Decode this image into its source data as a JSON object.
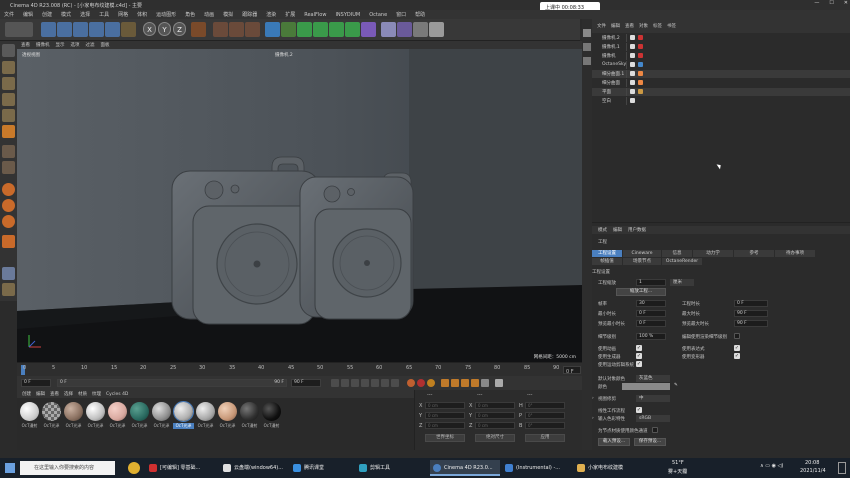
{
  "window": {
    "title": "Cinema 4D R23.008 (RC) - [小家电布纹建模.c4d] - 主要",
    "buttons": [
      "—",
      "☐",
      "✕"
    ]
  },
  "recording": {
    "label": "上课中 00:08:33"
  },
  "menubar": [
    "文件",
    "编辑",
    "创建",
    "模式",
    "选择",
    "工具",
    "网格",
    "体积",
    "运动图形",
    "角色",
    "动画",
    "模拟",
    "跟踪器",
    "渲染",
    "扩展",
    "RealFlow",
    "INSYDIUM",
    "Octane",
    "窗口",
    "帮助"
  ],
  "viewport": {
    "menu": [
      "查看",
      "摄像机",
      "显示",
      "选项",
      "过滤",
      "面板"
    ],
    "label": "透视视图",
    "camera": "摄像机.2",
    "grid_info": "网格间距：5000 cm"
  },
  "timeline": {
    "ticks": [
      "0",
      "5",
      "10",
      "15",
      "20",
      "25",
      "30",
      "35",
      "40",
      "45",
      "50",
      "55",
      "60",
      "65",
      "70",
      "75",
      "80",
      "85",
      "90"
    ],
    "current": "0 F",
    "start": "0 F",
    "field_start": "0 F",
    "end": "90 F",
    "end2": "90 F"
  },
  "materials": {
    "menu": [
      "创建",
      "编辑",
      "查看",
      "选择",
      "材质",
      "纹理",
      "Cycles 4D"
    ],
    "items": [
      {
        "label": "OcT漫射",
        "color": "#e8e8e8"
      },
      {
        "label": "OcT光泽",
        "color": "checker"
      },
      {
        "label": "OcT光泽",
        "color": "#8a7060"
      },
      {
        "label": "OcT光泽",
        "color": "#c0c0c0"
      },
      {
        "label": "OcT光泽",
        "color": "#d9a9a0"
      },
      {
        "label": "OcT光泽",
        "color": "#2a6a60"
      },
      {
        "label": "OcT光泽",
        "color": "#909090"
      },
      {
        "label": "OcT光泽",
        "color": "#b0b0b0"
      },
      {
        "label": "OcT光泽",
        "color": "#c89878"
      },
      {
        "label": "OcT光泽",
        "color": "#a8a8a8"
      },
      {
        "label": "OcT漫射",
        "color": "#303030"
      },
      {
        "label": "OcT漫射",
        "color": "#101010"
      }
    ]
  },
  "coords": {
    "header": [
      "---",
      "---",
      "---"
    ],
    "rows": [
      {
        "a": "X",
        "v1": "0 cm",
        "b": "X",
        "v2": "0 cm",
        "c": "H",
        "v3": "0°"
      },
      {
        "a": "Y",
        "v1": "0 cm",
        "b": "Y",
        "v2": "0 cm",
        "c": "P",
        "v3": "0°"
      },
      {
        "a": "Z",
        "v1": "0 cm",
        "b": "Z",
        "v2": "0 cm",
        "c": "B",
        "v3": "0°"
      }
    ],
    "mode1": "世界坐标",
    "mode2": "绝对尺寸",
    "apply": "应用"
  },
  "objects": {
    "menu": [
      "文件",
      "编辑",
      "查看",
      "对象",
      "标签",
      "书签"
    ],
    "items": [
      {
        "name": "摄像机.2",
        "tags": [
          "#ddd",
          "#c33"
        ]
      },
      {
        "name": "摄像机.1",
        "tags": [
          "#ddd",
          "#c33"
        ]
      },
      {
        "name": "摄像机",
        "tags": [
          "#ddd",
          "#c33"
        ]
      },
      {
        "name": "OctaneSky",
        "tags": [
          "#ddd",
          "#48c"
        ]
      },
      {
        "name": "细分曲面.1",
        "tags": [
          "#ddd",
          "#e84"
        ]
      },
      {
        "name": "细分曲面",
        "tags": [
          "#ddd",
          "#e84"
        ]
      },
      {
        "name": "平面",
        "tags": [
          "#ddd",
          "#c94"
        ]
      },
      {
        "name": "空白",
        "tags": [
          "#ddd"
        ]
      }
    ]
  },
  "attributes": {
    "menu": [
      "模式",
      "编辑",
      "用户数据"
    ],
    "title": "工程",
    "tabs": [
      "工程设置",
      "Cineware",
      "信息",
      "动力学",
      "参考",
      "待办事项",
      "帧插值",
      "场景节点",
      "OctaneRender"
    ],
    "section": "工程设置",
    "scale_label": "工程缩放",
    "scale_value": "1",
    "scale_unit": "厘米",
    "scale_btn": "缩放工程...",
    "fps_label": "帧率",
    "fps": "30",
    "time_label": "工程时长",
    "time": "0 F",
    "min_label": "最小时长",
    "min": "0 F",
    "max_label": "最大时长",
    "max": "90 F",
    "pmin_label": "预览最小时长",
    "pmin": "0 F",
    "pmax_label": "预览最大时长",
    "pmax": "90 F",
    "lod_label": "细节级别",
    "lod": "100 %",
    "lod_check": "编辑使用渲染细节级别",
    "use_anim": "使用动画",
    "use_expr": "使用表达式",
    "use_gen": "使用生成器",
    "use_deform": "使用变形器",
    "use_motion": "使用运动剪辑系统",
    "def_color_label": "默认对象颜色",
    "def_color": "灰蓝色",
    "color_label": "颜色",
    "view_clip": "视图修剪",
    "view_clip_val": "中",
    "linear": "线性工作流程",
    "input_color": "输入色彩特性",
    "input_color_val": "sRGB",
    "node_mat": "为节点材质使用颜色通道",
    "load_preset": "载入预设...",
    "save_preset": "保存预设..."
  },
  "taskbar": {
    "search": "在这里输入你要搜索的内容",
    "apps": [
      "[可编辑] 零基础...",
      "云盘端(window64)...",
      "腾讯课堂",
      "剪辑工具",
      "Cinema 4D R23.0...",
      "(Instrumental) -...",
      "小家电布纹建模"
    ],
    "weather": "51°F",
    "weather2": "雾+天霾",
    "time": "20:08",
    "date": "2021/11/4"
  },
  "colors": {
    "accent": "#4a7fbf",
    "viewport_bg": "#4a5055",
    "floor": "#111111"
  }
}
